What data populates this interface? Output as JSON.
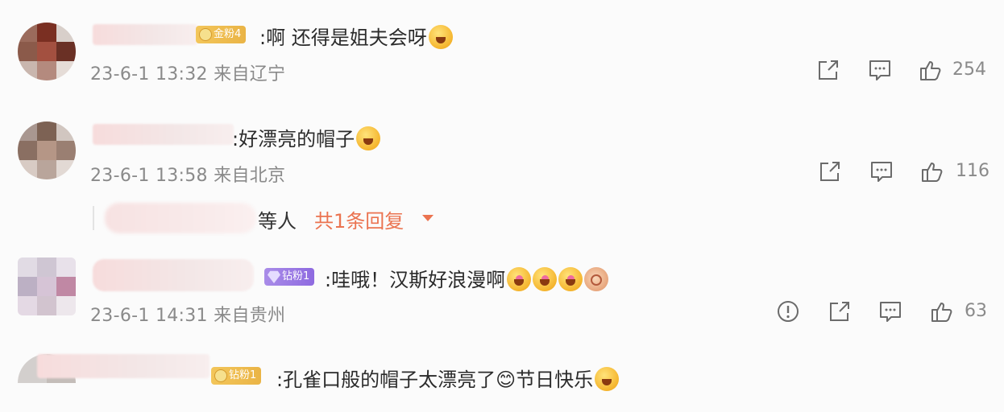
{
  "comments": [
    {
      "badge": "金粉4",
      "badge_type": "gold",
      "text": ":啊 还得是姐夫会呀",
      "emojis": [
        "laugh"
      ],
      "time": "23-6-1 13:32",
      "location": "来自辽宁",
      "likes": "254"
    },
    {
      "badge": "",
      "badge_type": "none",
      "text": ":好漂亮的帽子",
      "emojis": [
        "wow"
      ],
      "time": "23-6-1 13:58",
      "location": "来自北京",
      "likes": "116",
      "replies": {
        "suffix": "等人",
        "link": "共1条回复"
      }
    },
    {
      "badge": "钻粉1",
      "badge_type": "diamond",
      "text": ":哇哦！汉斯好浪漫啊",
      "emojis": [
        "heart-eyes",
        "heart-eyes",
        "heart-eyes",
        "shell"
      ],
      "time": "23-6-1 14:31",
      "location": "来自贵州",
      "likes": "63"
    },
    {
      "badge": "钻粉1",
      "badge_type": "gold",
      "text": ":孔雀口般的帽子太漂亮了😊节日快乐",
      "emojis": [
        "laugh"
      ],
      "time": "",
      "location": "",
      "likes": ""
    }
  ],
  "icons": {
    "share": "share-icon",
    "comment": "comment-icon",
    "like": "like-icon",
    "report": "report-icon"
  },
  "colors": {
    "accent": "#eb7350",
    "meta": "#8a8a8a",
    "icon": "#6b6b6b"
  }
}
